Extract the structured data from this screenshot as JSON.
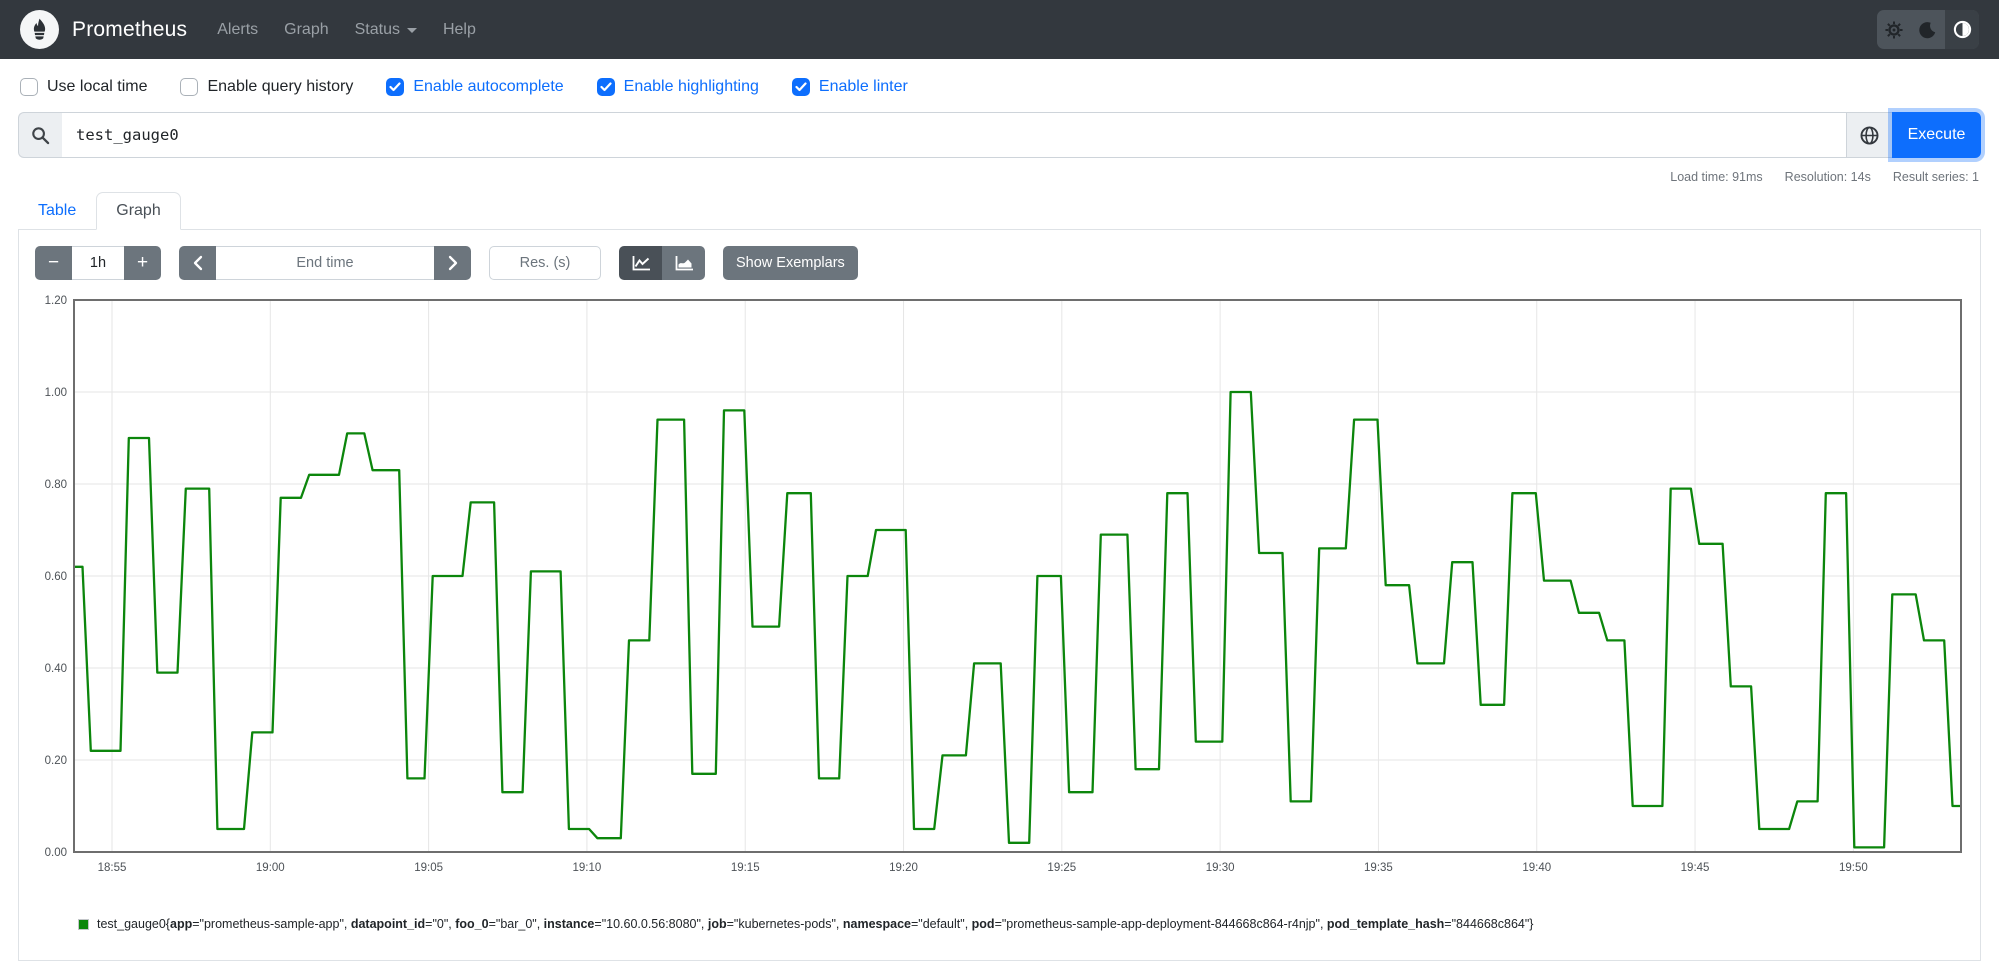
{
  "navbar": {
    "brand": "Prometheus",
    "items": [
      {
        "label": "Alerts",
        "has_caret": false
      },
      {
        "label": "Graph",
        "has_caret": false
      },
      {
        "label": "Status",
        "has_caret": true
      },
      {
        "label": "Help",
        "has_caret": false
      }
    ]
  },
  "options": [
    {
      "label": "Use local time",
      "checked": false
    },
    {
      "label": "Enable query history",
      "checked": false
    },
    {
      "label": "Enable autocomplete",
      "checked": true
    },
    {
      "label": "Enable highlighting",
      "checked": true
    },
    {
      "label": "Enable linter",
      "checked": true
    }
  ],
  "query": {
    "value": "test_gauge0",
    "execute_label": "Execute"
  },
  "stats": {
    "load_time": "Load time: 91ms",
    "resolution": "Resolution: 14s",
    "result_series": "Result series: 1"
  },
  "tabs": [
    {
      "label": "Table",
      "active": false
    },
    {
      "label": "Graph",
      "active": true
    }
  ],
  "controls": {
    "range_value": "1h",
    "minus_label": "−",
    "plus_label": "+",
    "end_time_placeholder": "End time",
    "res_placeholder": "Res. (s)",
    "show_exemplars_label": "Show Exemplars"
  },
  "chart_data": {
    "type": "line",
    "title": "test_gauge0 step line over time",
    "line_color": "#0c860c",
    "grid": true,
    "y_axis": {
      "min": 0,
      "max": 1.2,
      "ticks": [
        0,
        0.2,
        0.4,
        0.6,
        0.8,
        1.0,
        1.2
      ],
      "tick_labels": [
        "0.00",
        "0.20",
        "0.40",
        "0.60",
        "0.80",
        "1.00",
        "1.20"
      ]
    },
    "x_axis": {
      "domain_minutes": [
        53.8,
        113.4
      ],
      "ticks": [
        {
          "m": 55,
          "label": "18:55"
        },
        {
          "m": 60,
          "label": "19:00"
        },
        {
          "m": 65,
          "label": "19:05"
        },
        {
          "m": 70,
          "label": "19:10"
        },
        {
          "m": 75,
          "label": "19:15"
        },
        {
          "m": 80,
          "label": "19:20"
        },
        {
          "m": 85,
          "label": "19:25"
        },
        {
          "m": 90,
          "label": "19:30"
        },
        {
          "m": 95,
          "label": "19:35"
        },
        {
          "m": 100,
          "label": "19:40"
        },
        {
          "m": 105,
          "label": "19:45"
        },
        {
          "m": 110,
          "label": "19:50"
        }
      ]
    },
    "series": [
      {
        "name": "test_gauge0",
        "steps": [
          [
            53.8,
            0.62
          ],
          [
            54.2,
            0.22
          ],
          [
            55.4,
            0.9
          ],
          [
            56.3,
            0.39
          ],
          [
            57.2,
            0.79
          ],
          [
            58.2,
            0.05
          ],
          [
            59.3,
            0.26
          ],
          [
            60.2,
            0.77
          ],
          [
            61.1,
            0.82
          ],
          [
            62.3,
            0.91
          ],
          [
            63.1,
            0.83
          ],
          [
            64.2,
            0.16
          ],
          [
            65.0,
            0.6
          ],
          [
            66.2,
            0.76
          ],
          [
            67.2,
            0.13
          ],
          [
            68.1,
            0.61
          ],
          [
            69.3,
            0.05
          ],
          [
            70.2,
            0.03
          ],
          [
            71.2,
            0.46
          ],
          [
            72.1,
            0.94
          ],
          [
            73.2,
            0.17
          ],
          [
            74.2,
            0.96
          ],
          [
            75.1,
            0.49
          ],
          [
            76.2,
            0.78
          ],
          [
            77.2,
            0.16
          ],
          [
            78.1,
            0.6
          ],
          [
            79.0,
            0.7
          ],
          [
            80.2,
            0.05
          ],
          [
            81.1,
            0.21
          ],
          [
            82.1,
            0.41
          ],
          [
            83.2,
            0.02
          ],
          [
            84.1,
            0.6
          ],
          [
            85.1,
            0.13
          ],
          [
            86.1,
            0.69
          ],
          [
            87.2,
            0.18
          ],
          [
            88.2,
            0.78
          ],
          [
            89.1,
            0.24
          ],
          [
            90.2,
            1.0
          ],
          [
            91.1,
            0.65
          ],
          [
            92.1,
            0.11
          ],
          [
            93.0,
            0.66
          ],
          [
            94.1,
            0.94
          ],
          [
            95.1,
            0.58
          ],
          [
            96.1,
            0.41
          ],
          [
            97.2,
            0.63
          ],
          [
            98.1,
            0.32
          ],
          [
            99.1,
            0.78
          ],
          [
            100.1,
            0.59
          ],
          [
            101.2,
            0.52
          ],
          [
            102.1,
            0.46
          ],
          [
            102.9,
            0.1
          ],
          [
            104.1,
            0.79
          ],
          [
            105.0,
            0.67
          ],
          [
            106.0,
            0.36
          ],
          [
            106.9,
            0.05
          ],
          [
            108.1,
            0.11
          ],
          [
            109.0,
            0.78
          ],
          [
            109.9,
            0.01
          ],
          [
            111.1,
            0.56
          ],
          [
            112.1,
            0.46
          ],
          [
            113.0,
            0.1
          ]
        ]
      }
    ]
  },
  "legend": {
    "metric": "test_gauge0",
    "labels": [
      [
        "app",
        "prometheus-sample-app"
      ],
      [
        "datapoint_id",
        "0"
      ],
      [
        "foo_0",
        "bar_0"
      ],
      [
        "instance",
        "10.60.0.56:8080"
      ],
      [
        "job",
        "kubernetes-pods"
      ],
      [
        "namespace",
        "default"
      ],
      [
        "pod",
        "prometheus-sample-app-deployment-844668c864-r4njp"
      ],
      [
        "pod_template_hash",
        "844668c864"
      ]
    ]
  },
  "colors": {
    "accent": "#0d6efd",
    "series_green": "#0c860c",
    "navbar_bg": "#33383e",
    "button_gray": "#6c757d"
  }
}
